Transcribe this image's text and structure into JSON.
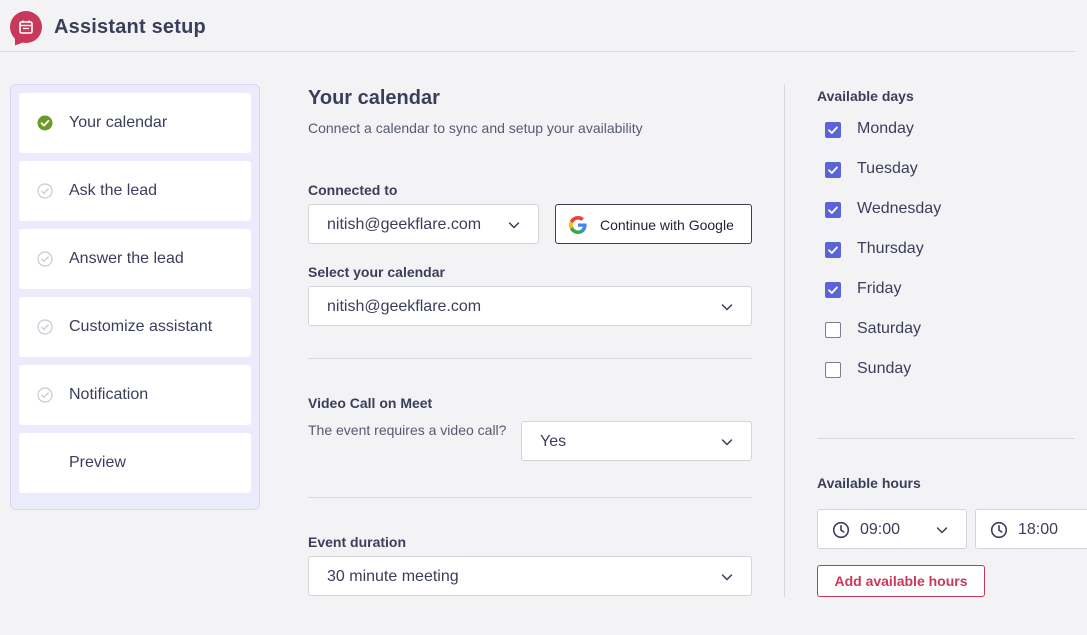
{
  "header": {
    "title": "Assistant setup",
    "logo_icon": "calendar-icon"
  },
  "colors": {
    "accent": "#5965d6",
    "brand": "#c9385a",
    "success": "#6a9a2a"
  },
  "steps": [
    {
      "label": "Your calendar",
      "status": "complete"
    },
    {
      "label": "Ask the lead",
      "status": "pending"
    },
    {
      "label": "Answer the lead",
      "status": "pending"
    },
    {
      "label": "Customize assistant",
      "status": "pending"
    },
    {
      "label": "Notification",
      "status": "pending"
    },
    {
      "label": "Preview",
      "status": "none"
    }
  ],
  "calendar": {
    "title": "Your calendar",
    "subtitle": "Connect a calendar to sync and setup your availability",
    "connected_label": "Connected to",
    "connected_value": "nitish@geekflare.com",
    "google_button": "Continue with Google",
    "select_label": "Select your calendar",
    "select_value": "nitish@geekflare.com",
    "video_label": "Video Call on Meet",
    "video_help": "The event requires a video call?",
    "video_value": "Yes",
    "duration_label": "Event duration",
    "duration_value": "30 minute meeting"
  },
  "availability": {
    "days_label": "Available days",
    "days": [
      {
        "label": "Monday",
        "checked": true
      },
      {
        "label": "Tuesday",
        "checked": true
      },
      {
        "label": "Wednesday",
        "checked": true
      },
      {
        "label": "Thursday",
        "checked": true
      },
      {
        "label": "Friday",
        "checked": true
      },
      {
        "label": "Saturday",
        "checked": false
      },
      {
        "label": "Sunday",
        "checked": false
      }
    ],
    "hours_label": "Available hours",
    "start_time": "09:00",
    "end_time": "18:00",
    "add_hours_button": "Add available hours"
  }
}
